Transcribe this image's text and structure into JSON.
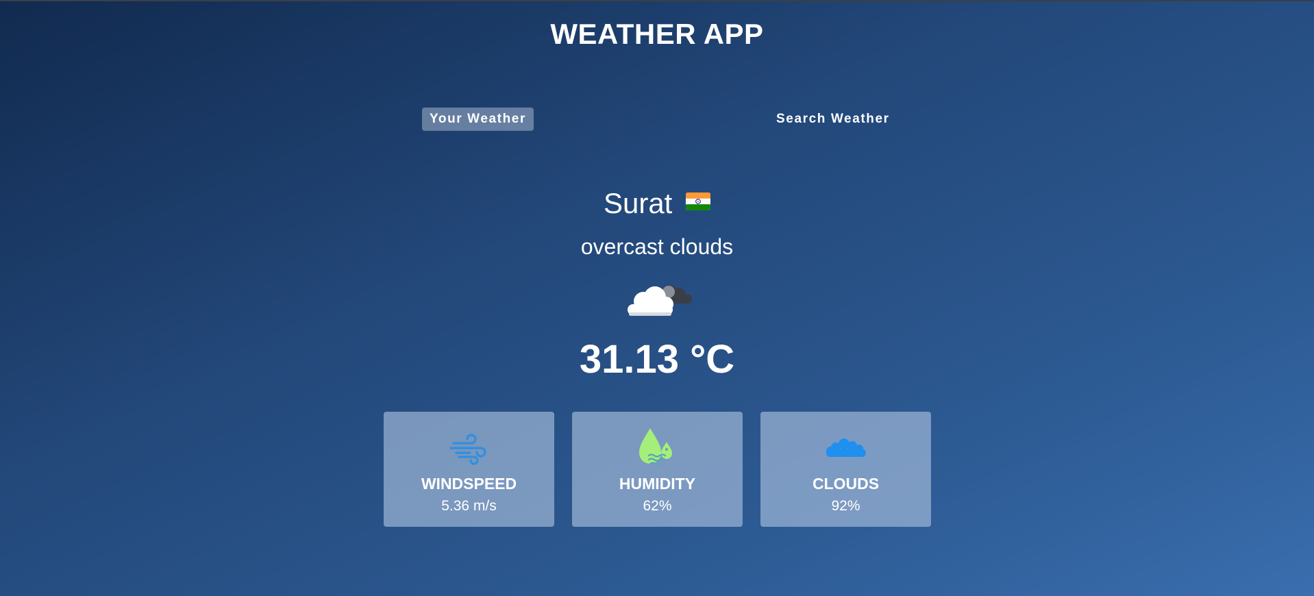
{
  "app": {
    "title": "WEATHER APP"
  },
  "tabs": [
    {
      "label": "Your Weather",
      "active": true
    },
    {
      "label": "Search Weather",
      "active": false
    }
  ],
  "weather": {
    "city": "Surat",
    "country_flag_icon": "india-flag-icon",
    "description": "overcast clouds",
    "condition_icon": "overcast-clouds-icon",
    "temperature": "31.13 °C"
  },
  "stats": [
    {
      "label": "WINDSPEED",
      "value": "5.36 m/s",
      "icon": "wind-icon",
      "icon_color": "#2f8fe0"
    },
    {
      "label": "HUMIDITY",
      "value": "62%",
      "icon": "humidity-drops-icon",
      "icon_color": "#a6ee7a"
    },
    {
      "label": "CLOUDS",
      "value": "92%",
      "icon": "cloud-icon",
      "icon_color": "#1f8ff0"
    }
  ],
  "colors": {
    "background_start": "#112a4f",
    "background_end": "#3a6eae",
    "active_tab": "#a8b8cf",
    "card": "#8ba2c4"
  }
}
